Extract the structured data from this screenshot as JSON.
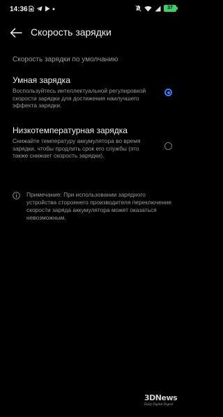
{
  "status_bar": {
    "time": "14:36",
    "left_icons": [
      "dual-sim-icon",
      "telegram-icon",
      "play-store-icon",
      "dot-icon"
    ],
    "right_icons": [
      "mute-icon",
      "wifi-icon",
      "signal-icon"
    ],
    "battery": "37"
  },
  "header": {
    "title": "Скорость зарядки",
    "back_icon": "back-arrow-icon"
  },
  "section": {
    "title": "Скорость зарядки по умолчанию"
  },
  "options": [
    {
      "title": "Умная зарядка",
      "description": "Воспользуйтесь интеллектуальной регулировкой скорости зарядки для достижения наилучшего эффекта зарядки.",
      "selected": true
    },
    {
      "title": "Низкотемпературная зарядка",
      "description": "Снижайте температуру аккумулятора во время зарядки, чтобы продлить срок его службы (это также снижает скорость зарядки).",
      "selected": false
    }
  ],
  "note": {
    "icon": "info-icon",
    "text": "Примечание: При использовании зарядного устройства стороннего производителя переключение скорости заряда аккумулятора может оказаться невозможным."
  },
  "watermark": {
    "brand": "3DNews",
    "tagline": "Daily Digital Digest"
  },
  "colors": {
    "background": "#000000",
    "accent": "#3b7dff",
    "battery": "#3ecf6a",
    "secondary_text": "#9a9a9a"
  }
}
